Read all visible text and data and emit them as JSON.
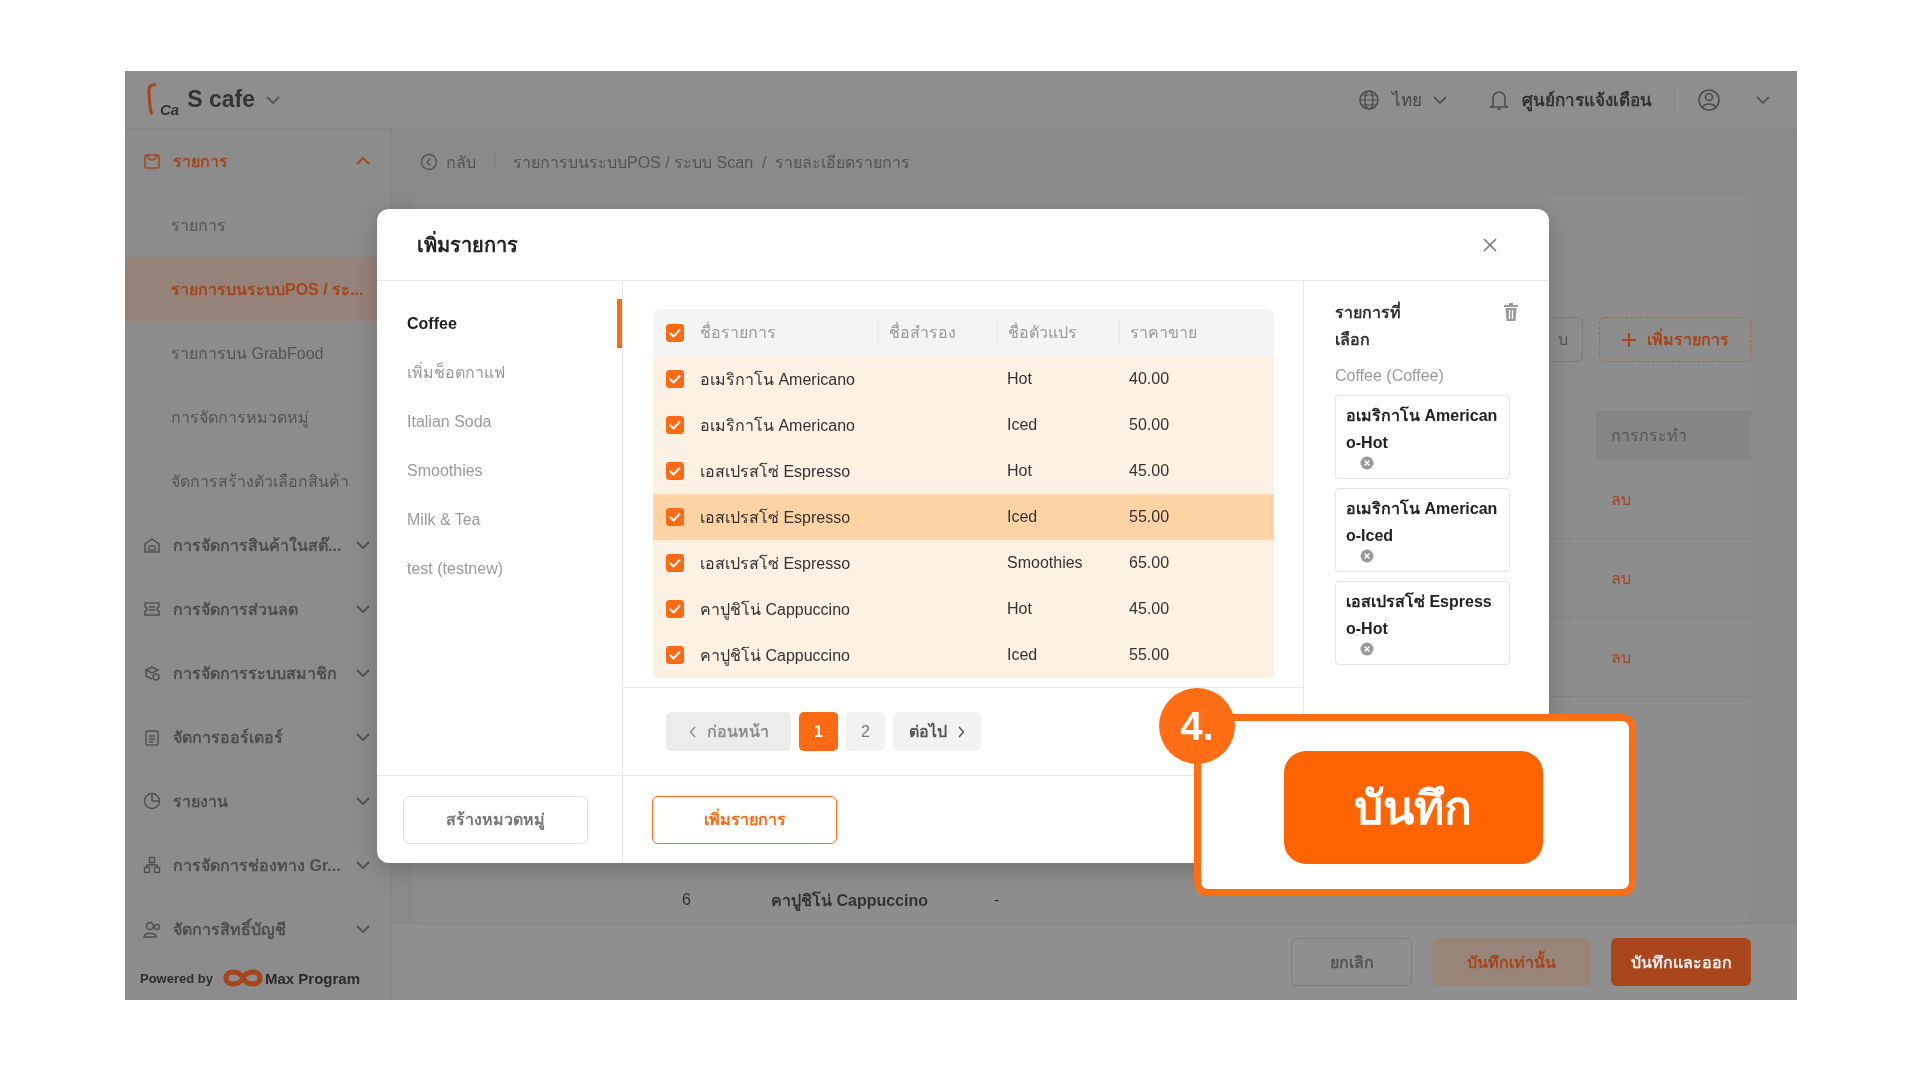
{
  "header": {
    "logo_text": "Ca",
    "app_name": "S cafe",
    "language": "ไทย",
    "notifications": "ศูนย์การแจ้งเตือน"
  },
  "sidebar": {
    "items": [
      {
        "label": "รายการ",
        "selected": true,
        "expanded": true,
        "children": [
          {
            "label": "รายการ",
            "selected": false
          },
          {
            "label": "รายการบนระบบPOS / ระ...",
            "selected": true
          },
          {
            "label": "รายการบน GrabFood",
            "selected": false
          },
          {
            "label": "การจัดการหมวดหมู่",
            "selected": false
          },
          {
            "label": "จัดการสร้างตัวเลือกสินค้า",
            "selected": false
          }
        ]
      },
      {
        "label": "การจัดการสินค้าในสต๊...",
        "selected": false,
        "expanded": false
      },
      {
        "label": "การจัดการส่วนลด",
        "selected": false,
        "expanded": false
      },
      {
        "label": "การจัดการระบบสมาชิก",
        "selected": false,
        "expanded": false
      },
      {
        "label": "จัดการออร์เดอร์",
        "selected": false,
        "expanded": false
      },
      {
        "label": "รายงาน",
        "selected": false,
        "expanded": false
      },
      {
        "label": "การจัดการช่องทาง Gr...",
        "selected": false,
        "expanded": false
      },
      {
        "label": "จัดการสิทธิ์บัญชี",
        "selected": false,
        "expanded": false
      }
    ],
    "powered_by": "Powered by",
    "brand": "Max Program"
  },
  "breadcrumb": {
    "back": "กลับ",
    "path": "รายการบนระบบPOS / ระบบ Scan  /  รายละเอียดรายการ"
  },
  "page": {
    "toolbar": [
      {
        "label": "บ",
        "kind": "plain"
      },
      {
        "label": "เพิ่มรายการ",
        "kind": "add"
      }
    ],
    "table": {
      "columns": [
        "การกระทำ"
      ],
      "rows": [
        {
          "action": "ลบ"
        },
        {
          "action": "ลบ"
        },
        {
          "action": "ลบ"
        },
        {
          "number": "6",
          "name": "คาปูชิโน่ Cappuccino",
          "column_3": "-"
        }
      ]
    },
    "footer_buttons": [
      {
        "label": "ยกเลิก",
        "kind": "default"
      },
      {
        "label": "บันทึกเท่านั้น",
        "kind": "light"
      },
      {
        "label": "บันทึกและออก",
        "kind": "primary"
      }
    ]
  },
  "modal": {
    "title": "เพิ่มรายการ",
    "categories": [
      {
        "label": "Coffee",
        "selected": true
      },
      {
        "label": "เพิ่มช็อตกาแฟ",
        "selected": false
      },
      {
        "label": "Italian Soda",
        "selected": false
      },
      {
        "label": "Smoothies",
        "selected": false
      },
      {
        "label": "Milk & Tea",
        "selected": false
      },
      {
        "label": "test (testnew)",
        "selected": false
      }
    ],
    "create_category": "สร้างหมวดหมู่",
    "table": {
      "all_checked": true,
      "columns": [
        "ชื่อรายการ",
        "ชื่อสำรอง",
        "ชื่อตัวแปร",
        "ราคาขาย"
      ],
      "rows": [
        {
          "name": "อเมริกาโน Americano",
          "variant": "Hot",
          "price": "40.00",
          "checked": true,
          "highlighted": false
        },
        {
          "name": "อเมริกาโน Americano",
          "variant": "Iced",
          "price": "50.00",
          "checked": true,
          "highlighted": false
        },
        {
          "name": "เอสเปรสโซ่ Espresso",
          "variant": "Hot",
          "price": "45.00",
          "checked": true,
          "highlighted": false
        },
        {
          "name": "เอสเปรสโซ่ Espresso",
          "variant": "Iced",
          "price": "55.00",
          "checked": true,
          "highlighted": true
        },
        {
          "name": "เอสเปรสโซ่ Espresso",
          "variant": "Smoothies",
          "price": "65.00",
          "checked": true,
          "highlighted": false
        },
        {
          "name": "คาปูชิโน่ Cappuccino",
          "variant": "Hot",
          "price": "45.00",
          "checked": true,
          "highlighted": false
        },
        {
          "name": "คาปูชิโน่ Cappuccino",
          "variant": "Iced",
          "price": "55.00",
          "checked": true,
          "highlighted": false
        }
      ]
    },
    "pagination": {
      "previous": {
        "label": "ก่อนหน้า",
        "disabled": true
      },
      "pages": [
        {
          "label": "1",
          "selected": true
        },
        {
          "label": "2",
          "selected": false
        }
      ],
      "next": {
        "label": "ต่อไป",
        "disabled": false
      }
    },
    "add_button": "เพิ่มรายการ",
    "selected_panel": {
      "title": "รายการที่ เลือก",
      "group": "Coffee (Coffee)",
      "items": [
        "อเมริกาโน Americano-Hot",
        "อเมริกาโน Americano-Iced",
        "เอสเปรสโซ่ Espresso-Hot"
      ]
    }
  },
  "callout": {
    "step": "4.",
    "button": "บันทึก"
  }
}
